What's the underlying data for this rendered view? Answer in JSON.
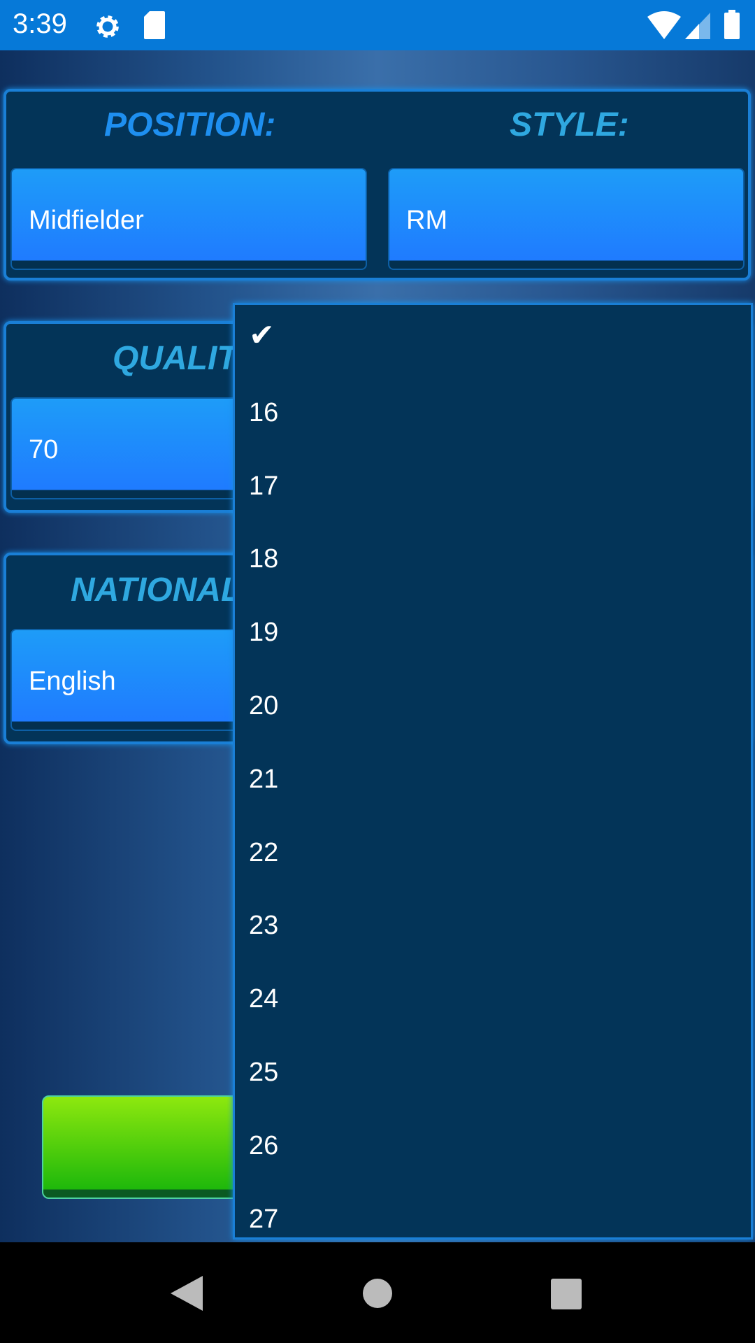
{
  "status_bar": {
    "time": "3:39",
    "icons": [
      "settings-icon",
      "sd-card-icon",
      "wifi-icon",
      "signal-icon",
      "battery-icon"
    ],
    "color": "#0679d8"
  },
  "form": {
    "position": {
      "label": "POSITION:",
      "value": "Midfielder"
    },
    "style": {
      "label": "STYLE:",
      "value": "RM"
    },
    "quality": {
      "label": "QUALIT",
      "value": "70"
    },
    "nationality": {
      "label": "NATIONAL",
      "value": "English"
    }
  },
  "dropdown": {
    "selected_icon": "check-icon",
    "check": "✔",
    "items": [
      "16",
      "17",
      "18",
      "19",
      "20",
      "21",
      "22",
      "23",
      "24",
      "25",
      "26",
      "27"
    ]
  },
  "nav_bar": {
    "icons": [
      "back-icon",
      "home-icon",
      "recents-icon"
    ]
  }
}
